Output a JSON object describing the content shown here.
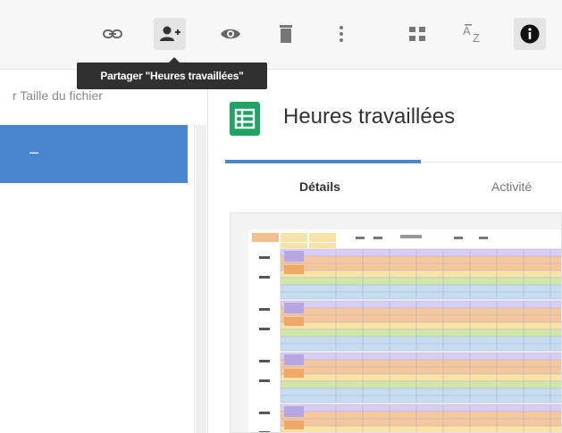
{
  "toolbar": {
    "buttons": [
      {
        "name": "link-icon",
        "label": "Lien"
      },
      {
        "name": "share-person-icon",
        "label": "Partager"
      },
      {
        "name": "eye-icon",
        "label": "Aperçu"
      },
      {
        "name": "trash-icon",
        "label": "Supprimer"
      },
      {
        "name": "more-vert-icon",
        "label": "Plus"
      },
      {
        "name": "grid-view-icon",
        "label": "Vue grille"
      },
      {
        "name": "sort-az-icon",
        "label": "A Z"
      },
      {
        "name": "info-icon",
        "label": "Détails"
      }
    ],
    "tooltip": "Partager \"Heures travaillées\""
  },
  "list": {
    "column_header": "r Taille du fichier",
    "selected_value": "–"
  },
  "details": {
    "title": "Heures travaillées",
    "tabs": [
      {
        "label": "Détails",
        "active": true
      },
      {
        "label": "Activité",
        "active": false
      }
    ]
  },
  "colors": {
    "accent": "#4a86cf",
    "sheets_green": "#1fa463",
    "tooltip_bg": "#303030"
  }
}
